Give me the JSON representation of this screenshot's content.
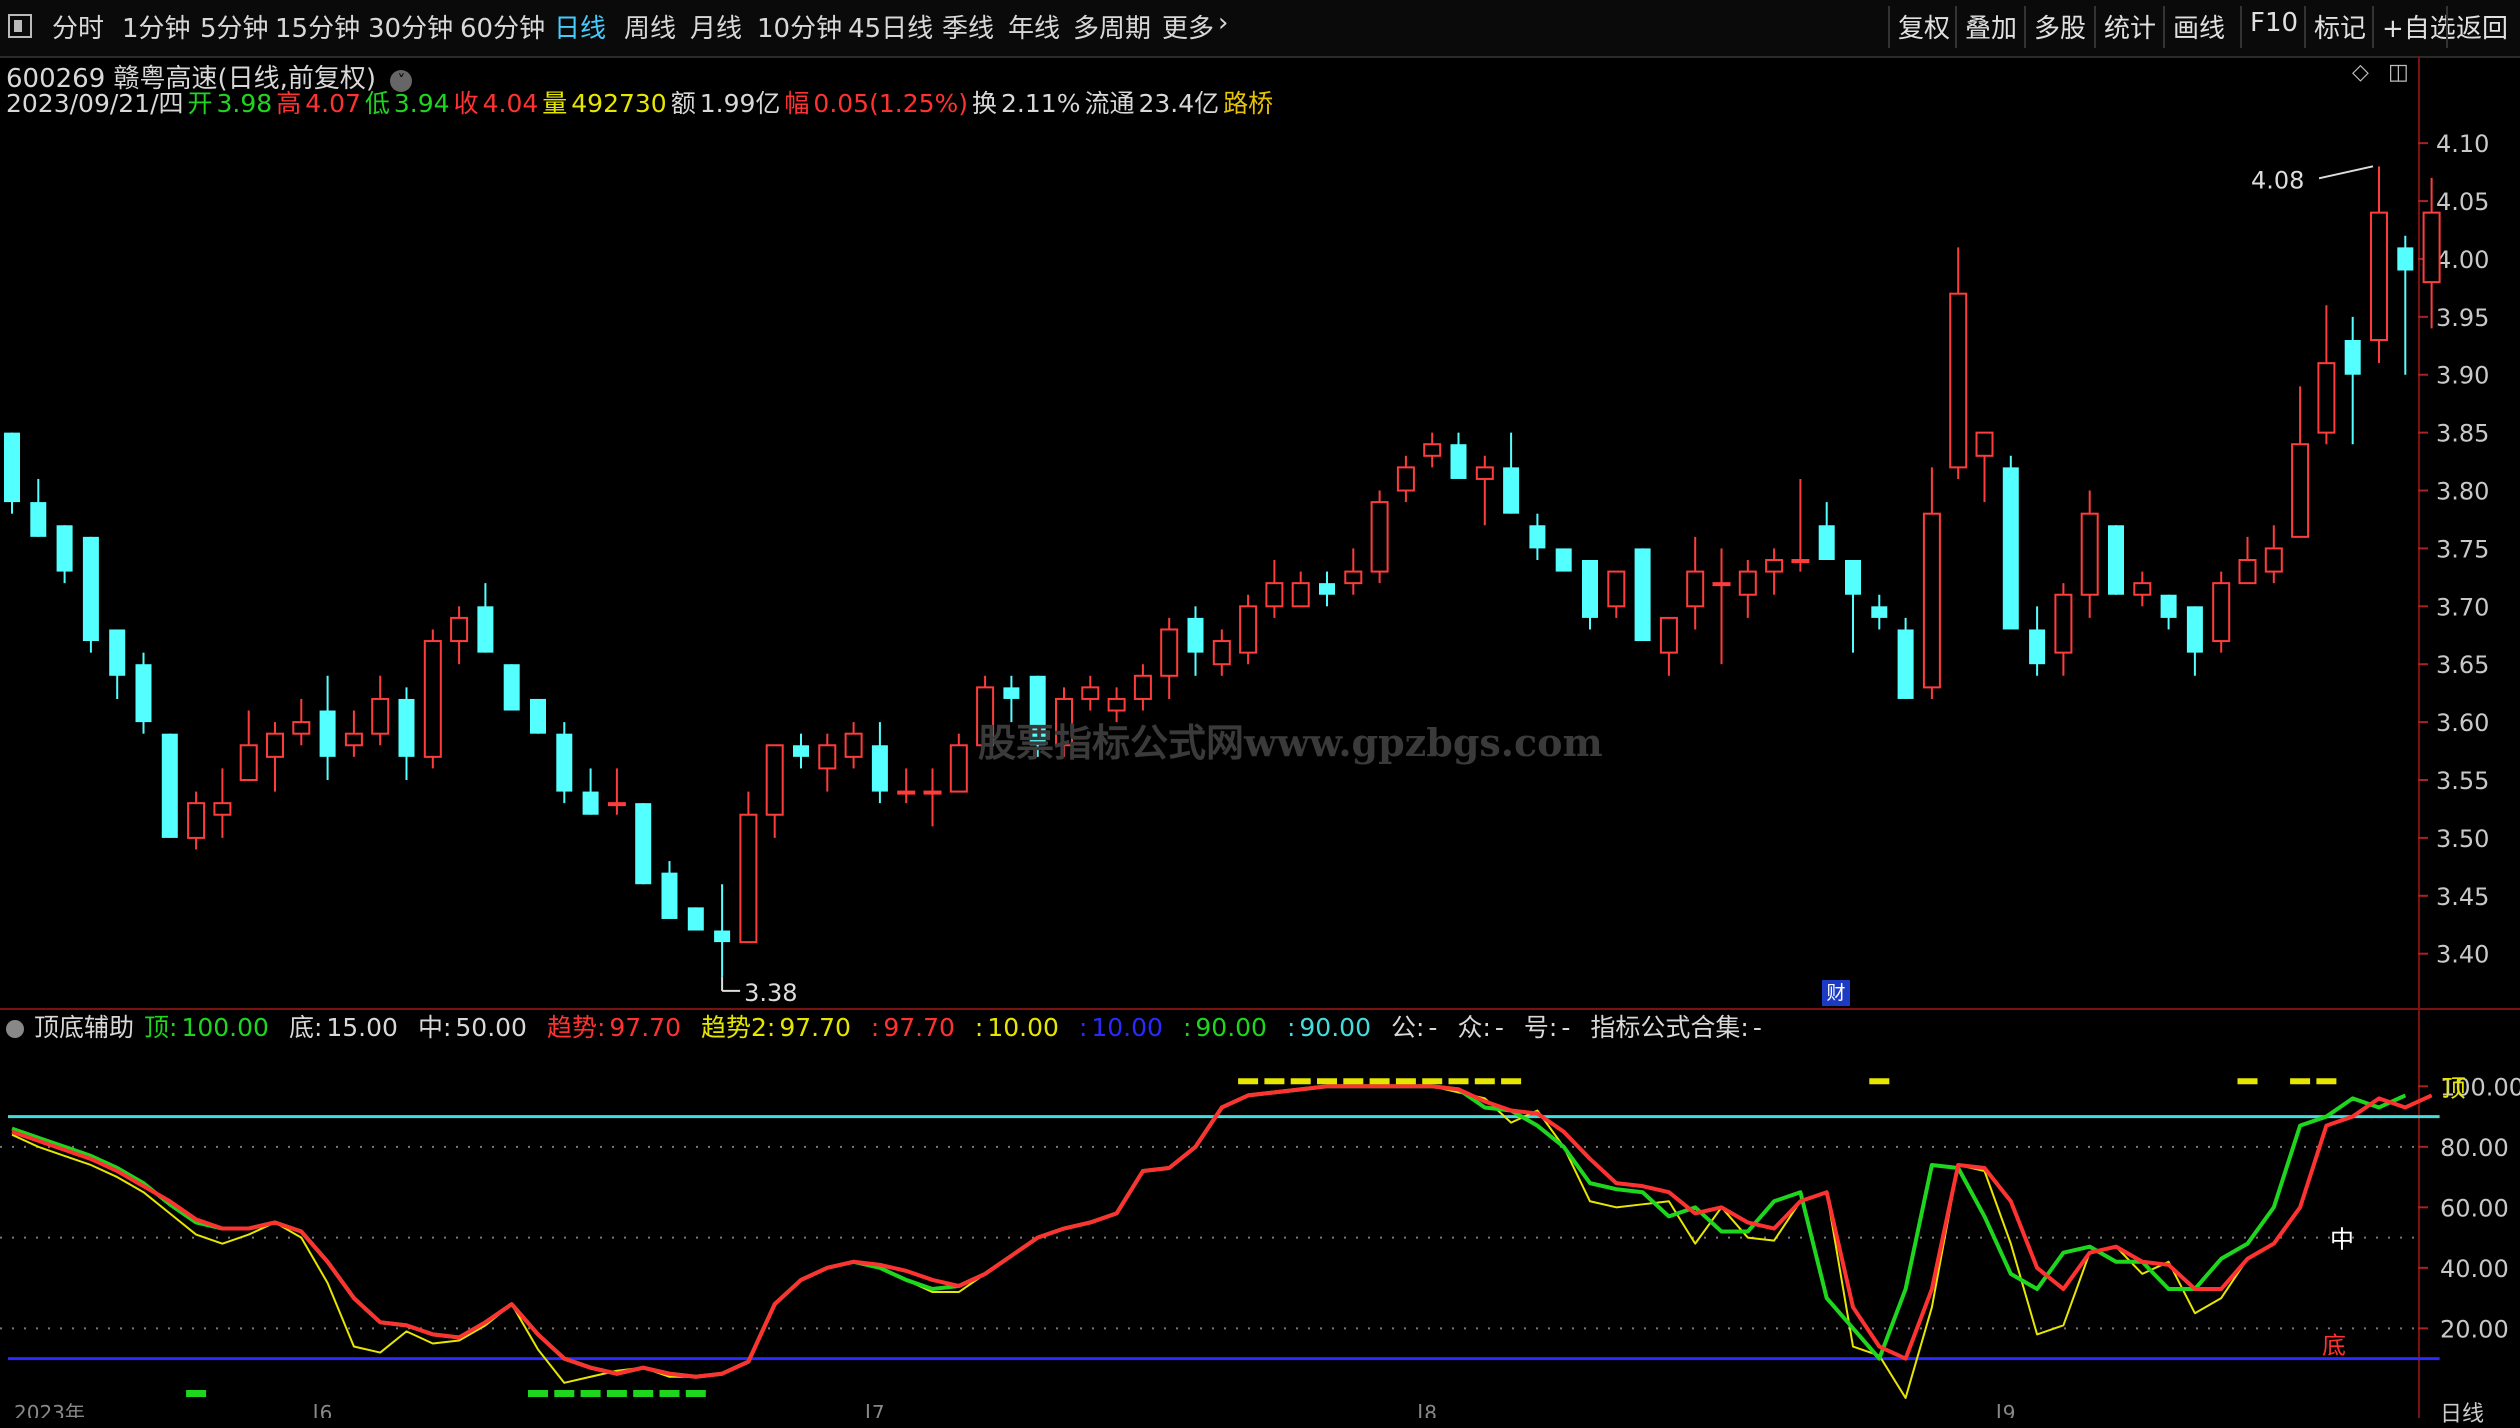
{
  "toolbar": {
    "periods": [
      "分时",
      "1分钟",
      "5分钟",
      "15分钟",
      "30分钟",
      "60分钟",
      "日线",
      "周线",
      "月线",
      "10分钟",
      "45日线",
      "季线",
      "年线",
      "多周期",
      "更多"
    ],
    "active_period": "日线",
    "more_arrow": "›",
    "right_buttons": [
      "复权",
      "叠加",
      "多股",
      "统计",
      "画线",
      "F10",
      "标记",
      "+自选",
      "返回"
    ]
  },
  "stock": {
    "title": "600269 赣粤高速(日线,前复权)",
    "date": "2023/09/21/四",
    "open_label": "开",
    "open": "3.98",
    "high_label": "高",
    "high": "4.07",
    "low_label": "低",
    "low": "3.94",
    "close_label": "收",
    "close": "4.04",
    "volume_label": "量",
    "volume": "492730",
    "amount_label": "额",
    "amount": "1.99亿",
    "change_label": "幅",
    "change": "0.05(1.25%)",
    "turnover_label": "换",
    "turnover": "2.11%",
    "float_label": "流通",
    "float": "23.4亿",
    "concept": "路桥"
  },
  "watermark": "股票指标公式网www.gpzbgs.com",
  "cai_badge": "财",
  "indicator": {
    "name": "顶底辅助",
    "items": [
      {
        "label": "顶:",
        "value": "100.00",
        "color": "#1fd61f"
      },
      {
        "label": "底:",
        "value": "15.00",
        "color": "#d8d8d8"
      },
      {
        "label": "中:",
        "value": "50.00",
        "color": "#d8d8d8"
      },
      {
        "label": "趋势:",
        "value": "97.70",
        "color": "#ff3232"
      },
      {
        "label": "趋势2:",
        "value": "97.70",
        "color": "#e6e600"
      },
      {
        "label": ":",
        "value": "97.70",
        "color": "#ff3232"
      },
      {
        "label": ":",
        "value": "10.00",
        "color": "#e6e600"
      },
      {
        "label": ":",
        "value": "10.00",
        "color": "#2a2aff"
      },
      {
        "label": ":",
        "value": "90.00",
        "color": "#1fd61f"
      },
      {
        "label": ":",
        "value": "90.00",
        "color": "#44dddd"
      },
      {
        "label": "公:",
        "value": "-",
        "color": "#d8d8d8"
      },
      {
        "label": "众:",
        "value": "-",
        "color": "#d8d8d8"
      },
      {
        "label": "号:",
        "value": "-",
        "color": "#d8d8d8"
      },
      {
        "label": "指标公式合集:",
        "value": "-",
        "color": "#d8d8d8"
      }
    ],
    "text_top": "顶",
    "text_mid": "中",
    "text_bottom": "底"
  },
  "axis_bottom_label": "日线",
  "x_month_labels": [
    "2023年",
    "6",
    "7",
    "8",
    "9"
  ],
  "chart_data": [
    {
      "type": "candlestick",
      "title": "600269 赣粤高速(日线,前复权)",
      "ylim": [
        3.36,
        4.12
      ],
      "yticks": [
        3.4,
        3.45,
        3.5,
        3.55,
        3.6,
        3.65,
        3.7,
        3.75,
        3.8,
        3.85,
        3.9,
        3.95,
        4.0,
        4.05,
        4.1
      ],
      "annotations": [
        {
          "text": "3.38",
          "at": "low"
        },
        {
          "text": "4.08",
          "at": "high"
        }
      ],
      "candles": [
        {
          "o": 3.85,
          "h": 3.85,
          "l": 3.78,
          "c": 3.79
        },
        {
          "o": 3.79,
          "h": 3.81,
          "l": 3.76,
          "c": 3.76
        },
        {
          "o": 3.77,
          "h": 3.77,
          "l": 3.72,
          "c": 3.73
        },
        {
          "o": 3.76,
          "h": 3.76,
          "l": 3.66,
          "c": 3.67
        },
        {
          "o": 3.68,
          "h": 3.68,
          "l": 3.62,
          "c": 3.64
        },
        {
          "o": 3.65,
          "h": 3.66,
          "l": 3.59,
          "c": 3.6
        },
        {
          "o": 3.59,
          "h": 3.59,
          "l": 3.5,
          "c": 3.5
        },
        {
          "o": 3.5,
          "h": 3.54,
          "l": 3.49,
          "c": 3.53
        },
        {
          "o": 3.52,
          "h": 3.56,
          "l": 3.5,
          "c": 3.53
        },
        {
          "o": 3.55,
          "h": 3.61,
          "l": 3.55,
          "c": 3.58
        },
        {
          "o": 3.57,
          "h": 3.6,
          "l": 3.54,
          "c": 3.59
        },
        {
          "o": 3.59,
          "h": 3.62,
          "l": 3.58,
          "c": 3.6
        },
        {
          "o": 3.61,
          "h": 3.64,
          "l": 3.55,
          "c": 3.57
        },
        {
          "o": 3.58,
          "h": 3.61,
          "l": 3.57,
          "c": 3.59
        },
        {
          "o": 3.59,
          "h": 3.64,
          "l": 3.58,
          "c": 3.62
        },
        {
          "o": 3.62,
          "h": 3.63,
          "l": 3.55,
          "c": 3.57
        },
        {
          "o": 3.57,
          "h": 3.68,
          "l": 3.56,
          "c": 3.67
        },
        {
          "o": 3.67,
          "h": 3.7,
          "l": 3.65,
          "c": 3.69
        },
        {
          "o": 3.7,
          "h": 3.72,
          "l": 3.66,
          "c": 3.66
        },
        {
          "o": 3.65,
          "h": 3.65,
          "l": 3.61,
          "c": 3.61
        },
        {
          "o": 3.62,
          "h": 3.62,
          "l": 3.59,
          "c": 3.59
        },
        {
          "o": 3.59,
          "h": 3.6,
          "l": 3.53,
          "c": 3.54
        },
        {
          "o": 3.54,
          "h": 3.56,
          "l": 3.52,
          "c": 3.52
        },
        {
          "o": 3.53,
          "h": 3.56,
          "l": 3.52,
          "c": 3.53
        },
        {
          "o": 3.53,
          "h": 3.53,
          "l": 3.46,
          "c": 3.46
        },
        {
          "o": 3.47,
          "h": 3.48,
          "l": 3.43,
          "c": 3.43
        },
        {
          "o": 3.44,
          "h": 3.44,
          "l": 3.42,
          "c": 3.42
        },
        {
          "o": 3.42,
          "h": 3.46,
          "l": 3.38,
          "c": 3.41
        },
        {
          "o": 3.41,
          "h": 3.54,
          "l": 3.41,
          "c": 3.52
        },
        {
          "o": 3.52,
          "h": 3.58,
          "l": 3.5,
          "c": 3.58
        },
        {
          "o": 3.58,
          "h": 3.59,
          "l": 3.56,
          "c": 3.57
        },
        {
          "o": 3.56,
          "h": 3.59,
          "l": 3.54,
          "c": 3.58
        },
        {
          "o": 3.57,
          "h": 3.6,
          "l": 3.56,
          "c": 3.59
        },
        {
          "o": 3.58,
          "h": 3.6,
          "l": 3.53,
          "c": 3.54
        },
        {
          "o": 3.54,
          "h": 3.56,
          "l": 3.53,
          "c": 3.54
        },
        {
          "o": 3.54,
          "h": 3.56,
          "l": 3.51,
          "c": 3.54
        },
        {
          "o": 3.54,
          "h": 3.59,
          "l": 3.54,
          "c": 3.58
        },
        {
          "o": 3.58,
          "h": 3.64,
          "l": 3.58,
          "c": 3.63
        },
        {
          "o": 3.63,
          "h": 3.64,
          "l": 3.6,
          "c": 3.62
        },
        {
          "o": 3.64,
          "h": 3.64,
          "l": 3.57,
          "c": 3.58
        },
        {
          "o": 3.58,
          "h": 3.63,
          "l": 3.57,
          "c": 3.62
        },
        {
          "o": 3.62,
          "h": 3.64,
          "l": 3.61,
          "c": 3.63
        },
        {
          "o": 3.61,
          "h": 3.63,
          "l": 3.6,
          "c": 3.62
        },
        {
          "o": 3.62,
          "h": 3.65,
          "l": 3.61,
          "c": 3.64
        },
        {
          "o": 3.64,
          "h": 3.69,
          "l": 3.62,
          "c": 3.68
        },
        {
          "o": 3.69,
          "h": 3.7,
          "l": 3.64,
          "c": 3.66
        },
        {
          "o": 3.65,
          "h": 3.68,
          "l": 3.64,
          "c": 3.67
        },
        {
          "o": 3.66,
          "h": 3.71,
          "l": 3.65,
          "c": 3.7
        },
        {
          "o": 3.7,
          "h": 3.74,
          "l": 3.69,
          "c": 3.72
        },
        {
          "o": 3.7,
          "h": 3.73,
          "l": 3.7,
          "c": 3.72
        },
        {
          "o": 3.72,
          "h": 3.73,
          "l": 3.7,
          "c": 3.71
        },
        {
          "o": 3.72,
          "h": 3.75,
          "l": 3.71,
          "c": 3.73
        },
        {
          "o": 3.73,
          "h": 3.8,
          "l": 3.72,
          "c": 3.79
        },
        {
          "o": 3.8,
          "h": 3.83,
          "l": 3.79,
          "c": 3.82
        },
        {
          "o": 3.83,
          "h": 3.85,
          "l": 3.82,
          "c": 3.84
        },
        {
          "o": 3.84,
          "h": 3.85,
          "l": 3.81,
          "c": 3.81
        },
        {
          "o": 3.81,
          "h": 3.83,
          "l": 3.77,
          "c": 3.82
        },
        {
          "o": 3.82,
          "h": 3.85,
          "l": 3.78,
          "c": 3.78
        },
        {
          "o": 3.77,
          "h": 3.78,
          "l": 3.74,
          "c": 3.75
        },
        {
          "o": 3.75,
          "h": 3.75,
          "l": 3.73,
          "c": 3.73
        },
        {
          "o": 3.74,
          "h": 3.74,
          "l": 3.68,
          "c": 3.69
        },
        {
          "o": 3.7,
          "h": 3.73,
          "l": 3.69,
          "c": 3.73
        },
        {
          "o": 3.75,
          "h": 3.75,
          "l": 3.67,
          "c": 3.67
        },
        {
          "o": 3.66,
          "h": 3.69,
          "l": 3.64,
          "c": 3.69
        },
        {
          "o": 3.7,
          "h": 3.76,
          "l": 3.68,
          "c": 3.73
        },
        {
          "o": 3.72,
          "h": 3.75,
          "l": 3.65,
          "c": 3.72
        },
        {
          "o": 3.71,
          "h": 3.74,
          "l": 3.69,
          "c": 3.73
        },
        {
          "o": 3.73,
          "h": 3.75,
          "l": 3.71,
          "c": 3.74
        },
        {
          "o": 3.74,
          "h": 3.81,
          "l": 3.73,
          "c": 3.74
        },
        {
          "o": 3.77,
          "h": 3.79,
          "l": 3.74,
          "c": 3.74
        },
        {
          "o": 3.74,
          "h": 3.74,
          "l": 3.66,
          "c": 3.71
        },
        {
          "o": 3.7,
          "h": 3.71,
          "l": 3.68,
          "c": 3.69
        },
        {
          "o": 3.68,
          "h": 3.69,
          "l": 3.62,
          "c": 3.62
        },
        {
          "o": 3.63,
          "h": 3.82,
          "l": 3.62,
          "c": 3.78
        },
        {
          "o": 3.82,
          "h": 4.01,
          "l": 3.81,
          "c": 3.97
        },
        {
          "o": 3.83,
          "h": 3.85,
          "l": 3.79,
          "c": 3.85
        },
        {
          "o": 3.82,
          "h": 3.83,
          "l": 3.68,
          "c": 3.68
        },
        {
          "o": 3.68,
          "h": 3.7,
          "l": 3.64,
          "c": 3.65
        },
        {
          "o": 3.66,
          "h": 3.72,
          "l": 3.64,
          "c": 3.71
        },
        {
          "o": 3.71,
          "h": 3.8,
          "l": 3.69,
          "c": 3.78
        },
        {
          "o": 3.77,
          "h": 3.77,
          "l": 3.71,
          "c": 3.71
        },
        {
          "o": 3.71,
          "h": 3.73,
          "l": 3.7,
          "c": 3.72
        },
        {
          "o": 3.71,
          "h": 3.71,
          "l": 3.68,
          "c": 3.69
        },
        {
          "o": 3.7,
          "h": 3.7,
          "l": 3.64,
          "c": 3.66
        },
        {
          "o": 3.67,
          "h": 3.73,
          "l": 3.66,
          "c": 3.72
        },
        {
          "o": 3.72,
          "h": 3.76,
          "l": 3.72,
          "c": 3.74
        },
        {
          "o": 3.73,
          "h": 3.77,
          "l": 3.72,
          "c": 3.75
        },
        {
          "o": 3.76,
          "h": 3.89,
          "l": 3.76,
          "c": 3.84
        },
        {
          "o": 3.85,
          "h": 3.96,
          "l": 3.84,
          "c": 3.91
        },
        {
          "o": 3.93,
          "h": 3.95,
          "l": 3.84,
          "c": 3.9
        },
        {
          "o": 3.93,
          "h": 4.08,
          "l": 3.91,
          "c": 4.04
        },
        {
          "o": 4.01,
          "h": 4.02,
          "l": 3.9,
          "c": 3.99
        },
        {
          "o": 3.98,
          "h": 4.07,
          "l": 3.94,
          "c": 4.04
        }
      ]
    },
    {
      "type": "line",
      "title": "顶底辅助",
      "ylim": [
        -5,
        112
      ],
      "yticks": [
        20,
        40,
        60,
        80,
        100
      ],
      "reference_lines": [
        {
          "value": 90,
          "color": "#44dddd"
        },
        {
          "value": 10,
          "color": "#2a2aff"
        }
      ],
      "dotted_levels": [
        20,
        50,
        80
      ],
      "series": [
        {
          "name": "趋势",
          "color": "#ff3232",
          "values": [
            85,
            82,
            79,
            76,
            72,
            67,
            62,
            56,
            53,
            53,
            55,
            52,
            42,
            30,
            22,
            21,
            18,
            17,
            22,
            28,
            18,
            10,
            7,
            5,
            7,
            5,
            4,
            5,
            9,
            28,
            36,
            40,
            42,
            41,
            39,
            36,
            34,
            38,
            44,
            50,
            53,
            55,
            58,
            72,
            73,
            80,
            93,
            97,
            98,
            99,
            100,
            100,
            100,
            100,
            100,
            99,
            95,
            92,
            91,
            85,
            76,
            68,
            67,
            65,
            58,
            60,
            55,
            53,
            62,
            65,
            27,
            14,
            10,
            33,
            74,
            73,
            62,
            40,
            33,
            45,
            47,
            42,
            41,
            33,
            33,
            43,
            48,
            60,
            87,
            90,
            96,
            93,
            97
          ]
        },
        {
          "name": "趋势2",
          "color": "#e6e600",
          "values": [
            84,
            80,
            77,
            74,
            70,
            65,
            58,
            51,
            48,
            51,
            55,
            50,
            35,
            14,
            12,
            19,
            15,
            16,
            21,
            28,
            13,
            2,
            4,
            6,
            7,
            4,
            4,
            5,
            9,
            28,
            36,
            40,
            42,
            40,
            36,
            32,
            32,
            38,
            44,
            50,
            53,
            55,
            58,
            72,
            73,
            80,
            93,
            97,
            98,
            99,
            100,
            100,
            100,
            100,
            100,
            98,
            96,
            88,
            92,
            80,
            62,
            60,
            61,
            62,
            48,
            60,
            50,
            49,
            62,
            65,
            14,
            11,
            -3,
            27,
            74,
            72,
            48,
            18,
            21,
            45,
            47,
            38,
            42,
            25,
            30,
            43,
            48,
            60,
            87,
            90,
            96,
            93,
            97
          ]
        },
        {
          "name": "",
          "color": "#1fd61f",
          "values": [
            86,
            83,
            80,
            77,
            73,
            68,
            61,
            55,
            53,
            53,
            55,
            52,
            42,
            30,
            22,
            21,
            18,
            17,
            22,
            28,
            18,
            10,
            7,
            5,
            7,
            5,
            4,
            5,
            9,
            28,
            36,
            40,
            42,
            40,
            36,
            33,
            34,
            38,
            44,
            50,
            53,
            55,
            58,
            72,
            73,
            80,
            93,
            97,
            98,
            99,
            100,
            100,
            100,
            100,
            100,
            99,
            93,
            92,
            87,
            80,
            68,
            66,
            65,
            57,
            60,
            52,
            52,
            62,
            65,
            30,
            20,
            10,
            33,
            74,
            73,
            57,
            38,
            33,
            45,
            47,
            42,
            42,
            33,
            33,
            43,
            48,
            60,
            87,
            90,
            96,
            93,
            97
          ]
        }
      ],
      "signal_top_bars": [
        47,
        48,
        49,
        50,
        51,
        52,
        53,
        54,
        55,
        56,
        57,
        71,
        85,
        87,
        88
      ],
      "signal_bottom_bars": [
        7,
        20,
        21,
        22,
        23,
        24,
        25,
        26
      ]
    }
  ]
}
